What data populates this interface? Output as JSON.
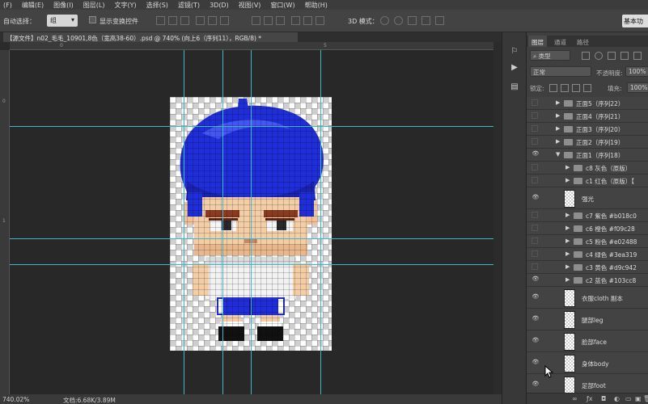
{
  "menu": {
    "items": [
      "(F)",
      "编辑(E)",
      "图像(I)",
      "图层(L)",
      "文字(Y)",
      "选择(S)",
      "滤镜(T)",
      "3D(D)",
      "视图(V)",
      "窗口(W)",
      "帮助(H)"
    ]
  },
  "options": {
    "auto_select_label": "自动选择：",
    "auto_select_value": "组",
    "show_transform_label": "显示变换控件",
    "mode_3d_label": "3D 模式：",
    "workspace_label": "基本功"
  },
  "document": {
    "tab_title": "【源文件】n02_毛毛_10901,8色（宽高38-60）.psd @ 740% (向上6（序列11），RGB/8) *"
  },
  "rulers": {
    "top_ticks": [
      "0",
      "5"
    ],
    "left_ticks": [
      "0",
      "1"
    ]
  },
  "status": {
    "zoom": "740.02%",
    "doc_size": "文档:6.68K/3.89M"
  },
  "panel": {
    "tabs": [
      "图层",
      "通道",
      "路径"
    ],
    "filter_kind": "类型",
    "blend_mode": "正常",
    "opacity_label": "不透明度:",
    "opacity_value": "100%",
    "lock_label": "锁定:",
    "fill_label": "填充:",
    "fill_value": "100%"
  },
  "layers": [
    {
      "name": "正面5（序列22）",
      "type": "group",
      "indent": 1,
      "visible": false,
      "expanded": false
    },
    {
      "name": "正面4（序列21）",
      "type": "group",
      "indent": 1,
      "visible": false,
      "expanded": false
    },
    {
      "name": "正面3（序列20）",
      "type": "group",
      "indent": 1,
      "visible": false,
      "expanded": false
    },
    {
      "name": "正面2（序列19）",
      "type": "group",
      "indent": 1,
      "visible": false,
      "expanded": false
    },
    {
      "name": "正面1（序列18）",
      "type": "group",
      "indent": 1,
      "visible": true,
      "expanded": true
    },
    {
      "name": "c8 灰色（原版）",
      "type": "group",
      "indent": 2,
      "visible": false,
      "expanded": false
    },
    {
      "name": "c1 红色（原版）【",
      "type": "group",
      "indent": 2,
      "visible": false,
      "expanded": false
    },
    {
      "name": "强光",
      "type": "layer",
      "visible": true
    },
    {
      "name": "c7 紫色 #b018c0",
      "type": "group",
      "indent": 2,
      "visible": false,
      "expanded": false
    },
    {
      "name": "c6 橙色 #f09c28",
      "type": "group",
      "indent": 2,
      "visible": false,
      "expanded": false
    },
    {
      "name": "c5 粉色 #e02488",
      "type": "group",
      "indent": 2,
      "visible": false,
      "expanded": false
    },
    {
      "name": "c4 绿色 #3ea319",
      "type": "group",
      "indent": 2,
      "visible": false,
      "expanded": false
    },
    {
      "name": "c3 黄色 #d9c942",
      "type": "group",
      "indent": 2,
      "visible": false,
      "expanded": false
    },
    {
      "name": "c2 蓝色 #103cc8",
      "type": "group",
      "indent": 2,
      "visible": true,
      "expanded": false
    },
    {
      "name": "衣服cloth 副本",
      "type": "layer",
      "visible": true
    },
    {
      "name": "腿部leg",
      "type": "layer",
      "visible": true
    },
    {
      "name": "脸部face",
      "type": "layer",
      "visible": true
    },
    {
      "name": "身体body",
      "type": "layer",
      "visible": true
    },
    {
      "name": "足部foot",
      "type": "layer",
      "visible": true
    }
  ],
  "colors": {
    "guide": "#3fb7c9",
    "hair_blue": "#1e2fd6",
    "ui_dark": "#2b2b2b"
  }
}
